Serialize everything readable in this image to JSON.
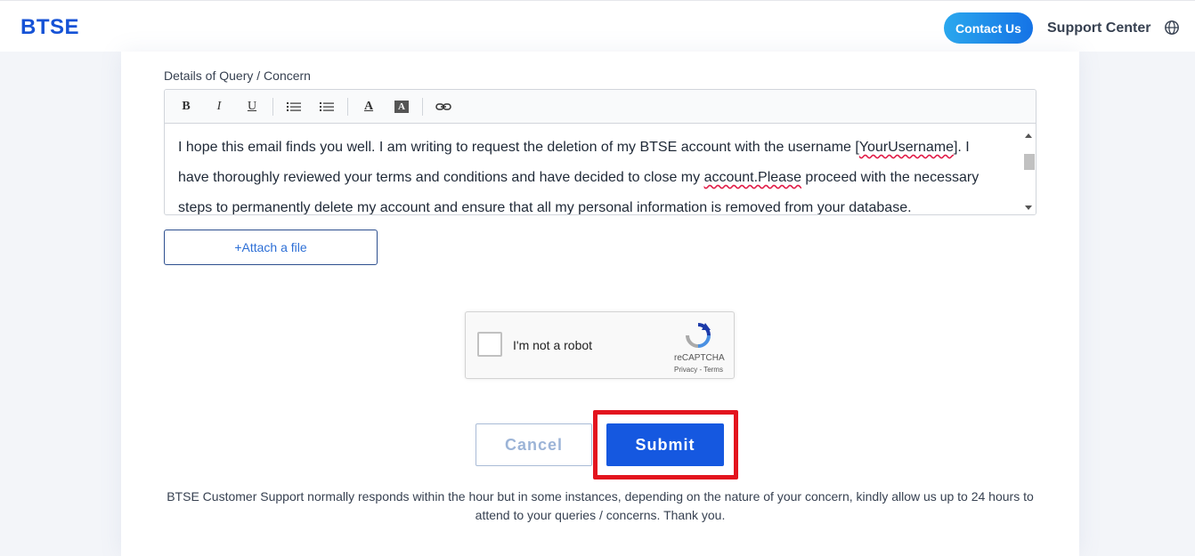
{
  "header": {
    "logo": "BTSE",
    "contact_label": "Contact Us",
    "support_label": "Support Center",
    "accent": "#1552d6"
  },
  "form": {
    "details_label": "Details of Query / Concern",
    "toolbar": {
      "bold": "B",
      "italic": "I",
      "underline": "U",
      "font_color": "A",
      "highlight": "A"
    },
    "body": {
      "line1_before": "I hope this email finds you well. I am writing to request the deletion of my BTSE account with the username [",
      "line1_spell": "YourUsername",
      "line1_after": "]. I have thoroughly reviewed your terms and conditions and have decided to close my ",
      "line2_spell": "account.Please",
      "line2_after": " proceed with the necessary steps to permanently delete my account and ensure that all my personal information is removed from your database."
    },
    "attach_label": "+Attach a file",
    "captcha": {
      "label": "I'm not a robot",
      "brand": "reCAPTCHA",
      "terms": "Privacy - Terms"
    },
    "cancel_label": "Cancel",
    "submit_label": "Submit",
    "note": "BTSE Customer Support normally responds within the hour but in some instances, depending on the nature of your concern, kindly allow us up to 24 hours to attend to your queries / concerns. Thank you.",
    "highlight_color": "#e3141e"
  }
}
